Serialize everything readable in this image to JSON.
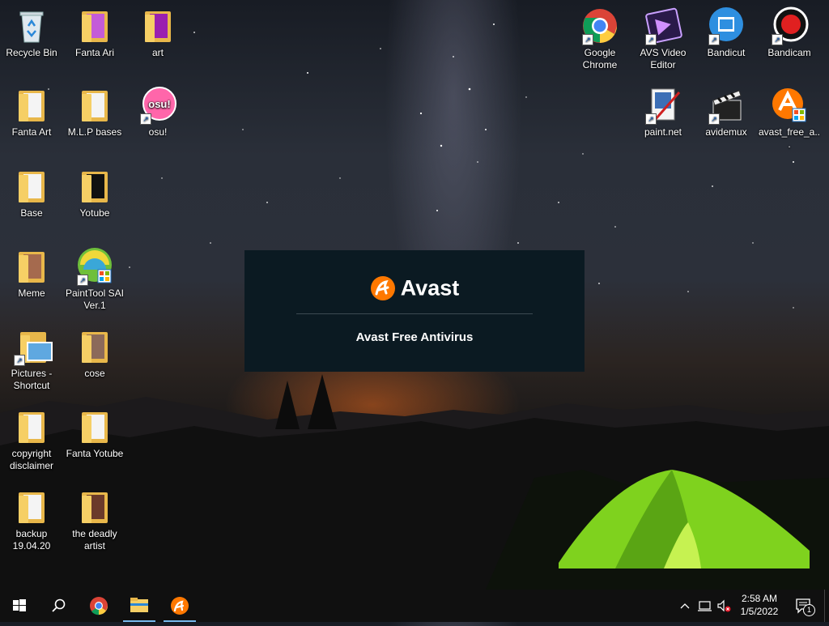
{
  "desktop": {
    "icons_left": [
      {
        "label": "Recycle Bin",
        "icon": "recycle-bin-icon"
      },
      {
        "label": "Fanta Ari",
        "icon": "folder-icon"
      },
      {
        "label": "art",
        "icon": "folder-icon"
      },
      {
        "label": "Fanta Art",
        "icon": "folder-icon"
      },
      {
        "label": "M.L.P bases",
        "icon": "folder-icon"
      },
      {
        "label": "osu!",
        "icon": "osu-icon"
      },
      {
        "label": "Base",
        "icon": "folder-icon"
      },
      {
        "label": "Yotube",
        "icon": "folder-icon"
      },
      {
        "label": "Meme",
        "icon": "folder-icon"
      },
      {
        "label": "PaintTool SAI Ver.1",
        "icon": "painttool-sai-icon"
      },
      {
        "label": "Pictures - Shortcut",
        "icon": "pictures-shortcut-icon"
      },
      {
        "label": "cose",
        "icon": "folder-icon"
      },
      {
        "label": "copyright disclaimer",
        "icon": "document-icon"
      },
      {
        "label": "Fanta Yotube",
        "icon": "folder-icon"
      },
      {
        "label": "backup 19.04.20",
        "icon": "folder-icon"
      },
      {
        "label": "the deadly artist",
        "icon": "folder-icon"
      }
    ],
    "icons_right": [
      {
        "label": "Google Chrome",
        "icon": "chrome-icon"
      },
      {
        "label": "AVS Video Editor",
        "icon": "avs-video-editor-icon"
      },
      {
        "label": "Bandicut",
        "icon": "bandicut-icon"
      },
      {
        "label": "Bandicam",
        "icon": "bandicam-icon"
      },
      {
        "label": "paint.net",
        "icon": "paint-net-icon"
      },
      {
        "label": "avidemux",
        "icon": "avidemux-icon"
      },
      {
        "label": "avast_free_a...",
        "icon": "avast-installer-icon"
      }
    ]
  },
  "splash": {
    "brand": "Avast",
    "product": "Avast Free Antivirus",
    "accent": "#ff7800"
  },
  "taskbar": {
    "time": "2:58 AM",
    "date": "1/5/2022",
    "notification_count": "1",
    "buttons": [
      "start-icon",
      "search-icon",
      "chrome-icon",
      "file-explorer-icon",
      "avast-icon"
    ]
  }
}
